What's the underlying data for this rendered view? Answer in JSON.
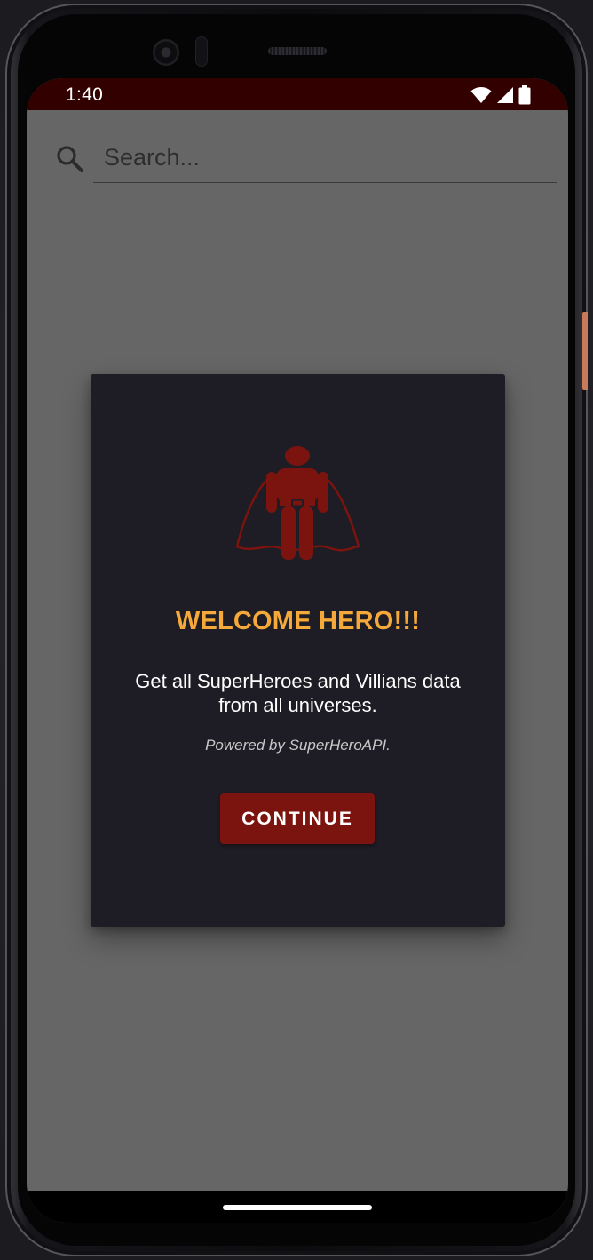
{
  "status_bar": {
    "time": "1:40",
    "icons": [
      "wifi-icon",
      "cell-signal-icon",
      "battery-icon"
    ]
  },
  "search": {
    "placeholder": "Search...",
    "icon": "search-icon"
  },
  "dialog": {
    "icon": "superhero-icon",
    "title": "WELCOME HERO!!!",
    "message": "Get all SuperHeroes and Villians data from all universes.",
    "credit": "Powered by SuperHeroAPI.",
    "continue_label": "CONTINUE"
  },
  "colors": {
    "status_bar": "#330000",
    "scrim": "#666666",
    "dialog_background": "#1e1c24",
    "title": "#f4a93a",
    "accent": "#7b140e"
  }
}
